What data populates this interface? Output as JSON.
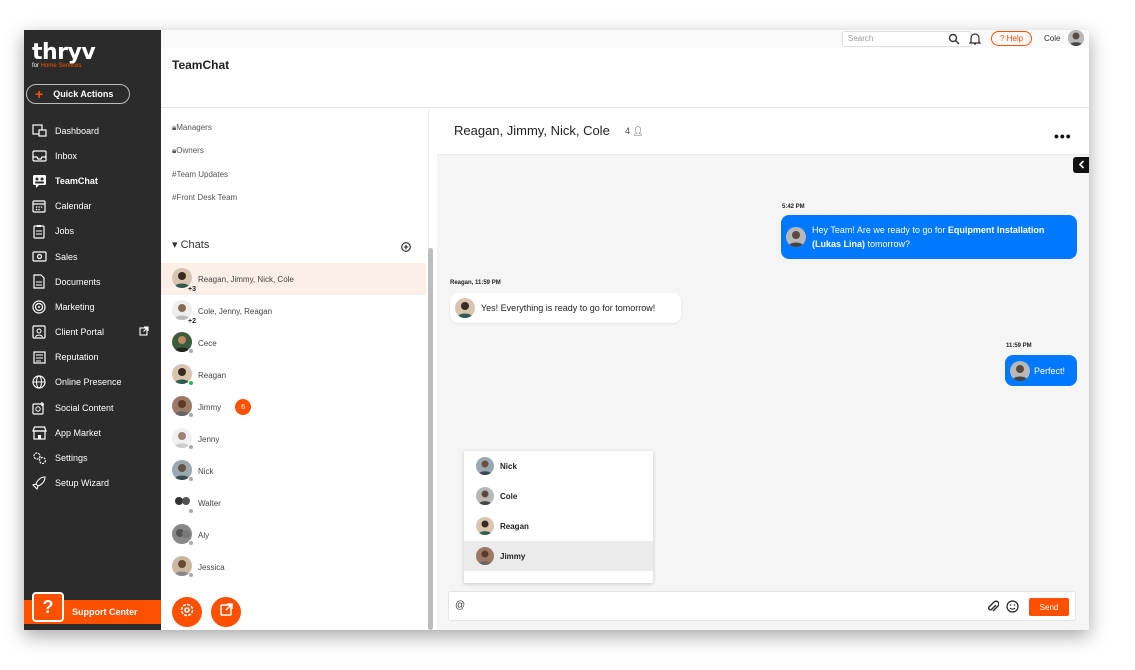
{
  "brand": {
    "logo": "thryv",
    "sub_prefix": "for ",
    "sub": "Home Services"
  },
  "quick_actions": "Quick Actions",
  "nav": [
    {
      "label": "Dashboard",
      "icon": "dashboard-icon"
    },
    {
      "label": "Inbox",
      "icon": "inbox-icon"
    },
    {
      "label": "TeamChat",
      "icon": "teamchat-icon"
    },
    {
      "label": "Calendar",
      "icon": "calendar-icon"
    },
    {
      "label": "Jobs",
      "icon": "jobs-icon"
    },
    {
      "label": "Sales",
      "icon": "sales-icon"
    },
    {
      "label": "Documents",
      "icon": "documents-icon"
    },
    {
      "label": "Marketing",
      "icon": "marketing-icon"
    },
    {
      "label": "Client Portal",
      "icon": "client-portal-icon"
    },
    {
      "label": "Reputation",
      "icon": "reputation-icon"
    },
    {
      "label": "Online Presence",
      "icon": "globe-icon"
    },
    {
      "label": "Social Content",
      "icon": "social-icon"
    },
    {
      "label": "App Market",
      "icon": "store-icon"
    },
    {
      "label": "Settings",
      "icon": "settings-icon"
    },
    {
      "label": "Setup Wizard",
      "icon": "rocket-icon"
    }
  ],
  "support": {
    "icon": "?",
    "label": "Support Center"
  },
  "topbar": {
    "search_placeholder": "Search",
    "help": "? Help",
    "user": "Cole"
  },
  "page_title": "TeamChat",
  "channels": [
    "Managers",
    "Owners",
    "#Team Updates",
    "#Front Desk Team"
  ],
  "chats_header": "Chats",
  "chats": [
    {
      "name": "Reagan, Jimmy, Nick, Cole",
      "extra": "+3",
      "active": true
    },
    {
      "name": "Cole, Jenny, Reagan",
      "extra": "+2"
    },
    {
      "name": "Cece"
    },
    {
      "name": "Reagan"
    },
    {
      "name": "Jimmy",
      "badge": "6"
    },
    {
      "name": "Jenny"
    },
    {
      "name": "Nick"
    },
    {
      "name": "Walter"
    },
    {
      "name": "Aly"
    },
    {
      "name": "Jessica"
    }
  ],
  "conversation": {
    "title": "Reagan, Jimmy, Nick, Cole",
    "members": "4",
    "messages": [
      {
        "time": "5:42 PM",
        "text_pre": "Hey Team! Are we ready to go for ",
        "text_bold": "Equipment Installation (Lukas Lina)",
        "text_post": " tomorrow?"
      },
      {
        "time": "Reagan, 11:59 PM",
        "text": "Yes!  Everything is ready to go for tomorrow!"
      },
      {
        "time": "11:59 PM",
        "text": "Perfect!"
      }
    ],
    "mentions": [
      "Nick",
      "Cole",
      "Reagan",
      "Jimmy"
    ],
    "composer_value": "@",
    "send": "Send"
  },
  "colors": {
    "accent": "#ff5000",
    "sidebar": "#2b2b2b",
    "bubble": "#0078ff"
  }
}
